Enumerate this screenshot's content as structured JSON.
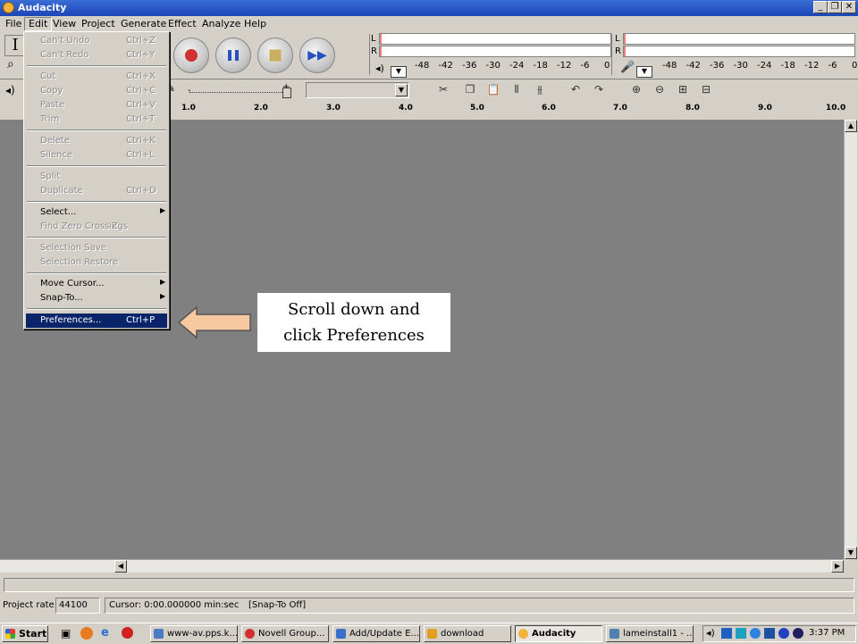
{
  "window": {
    "title": "Audacity",
    "minimize": "_",
    "restore": "❐",
    "close": "✕"
  },
  "menubar": [
    "File",
    "Edit",
    "View",
    "Project",
    "Generate",
    "Effect",
    "Analyze",
    "Help"
  ],
  "edit_menu": [
    {
      "label": "Can't Undo",
      "shortcut": "Ctrl+Z",
      "disabled": true
    },
    {
      "label": "Can't Redo",
      "shortcut": "Ctrl+Y",
      "disabled": true
    },
    {
      "label": "Cut",
      "shortcut": "Ctrl+X",
      "disabled": true
    },
    {
      "label": "Copy",
      "shortcut": "Ctrl+C",
      "disabled": true
    },
    {
      "label": "Paste",
      "shortcut": "Ctrl+V",
      "disabled": true
    },
    {
      "label": "Trim",
      "shortcut": "Ctrl+T",
      "disabled": true
    },
    {
      "label": "Delete",
      "shortcut": "Ctrl+K",
      "disabled": true
    },
    {
      "label": "Silence",
      "shortcut": "Ctrl+L",
      "disabled": true
    },
    {
      "label": "Split",
      "shortcut": "",
      "disabled": true
    },
    {
      "label": "Duplicate",
      "shortcut": "Ctrl+D",
      "disabled": true
    },
    {
      "label": "Select...",
      "shortcut": "",
      "disabled": false,
      "submenu": true
    },
    {
      "label": "Find Zero Crossings",
      "shortcut": "Z",
      "disabled": true
    },
    {
      "label": "Selection Save",
      "shortcut": "",
      "disabled": true
    },
    {
      "label": "Selection Restore",
      "shortcut": "",
      "disabled": true
    },
    {
      "label": "Move Cursor...",
      "shortcut": "",
      "disabled": false,
      "submenu": true
    },
    {
      "label": "Snap-To...",
      "shortcut": "",
      "disabled": false,
      "submenu": true
    },
    {
      "label": "Preferences...",
      "shortcut": "Ctrl+P",
      "disabled": false,
      "selected": true
    }
  ],
  "meters": {
    "playback_L": "L",
    "playback_R": "R",
    "record_L": "L",
    "record_R": "R",
    "playback_scale": [
      "-48",
      "-42",
      "-36",
      "-30",
      "-24",
      "-18",
      "-12",
      "-6",
      "0"
    ],
    "record_scale": [
      "-48",
      "-42",
      "-36",
      "-30",
      "-24",
      "-18",
      "-12",
      "-6",
      "0"
    ]
  },
  "ruler": [
    "1.0",
    "2.0",
    "3.0",
    "4.0",
    "5.0",
    "6.0",
    "7.0",
    "8.0",
    "9.0",
    "10.0"
  ],
  "status": {
    "project_rate_label": "Project rate:",
    "project_rate": "44100",
    "cursor": "Cursor: 0:00.000000 min:sec",
    "snap": "[Snap-To Off]"
  },
  "callout": {
    "line1": "Scroll down and",
    "line2": "click Preferences"
  },
  "taskbar": {
    "start": "Start",
    "items": [
      "www-av.pps.k...",
      "Novell Group...",
      "Add/Update E...",
      "download",
      "Audacity",
      "lameinstall1 - ..."
    ],
    "clock": "3:37 PM"
  },
  "colors": {
    "title_bar": "#1c46b7",
    "menu_highlight": "#0a246a",
    "track_bg": "#808080",
    "arrow_fill": "#f8c8a0"
  }
}
